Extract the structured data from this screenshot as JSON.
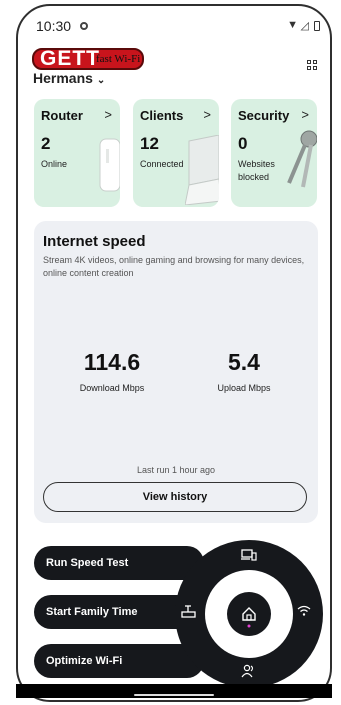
{
  "status": {
    "time": "10:30"
  },
  "header": {
    "logo_big": "GETT",
    "logo_small": "fast Wi-Fi",
    "network_name": "Hermans"
  },
  "cards": [
    {
      "title": "Router",
      "value": "2",
      "sub": "Online"
    },
    {
      "title": "Clients",
      "value": "12",
      "sub": "Connected"
    },
    {
      "title": "Security",
      "value": "0",
      "sub": "Websites blocked"
    }
  ],
  "speed": {
    "title": "Internet speed",
    "description": "Stream 4K videos, online gaming and browsing for many devices, online content creation",
    "download_value": "114.6",
    "download_label": "Download Mbps",
    "upload_value": "5.4",
    "upload_label": "Upload Mbps",
    "last_run": "Last run 1 hour ago",
    "history_button": "View history"
  },
  "actions": {
    "run_speed_test": "Run Speed Test",
    "start_family_time": "Start Family Time",
    "optimize_wifi": "Optimize Wi-Fi"
  }
}
